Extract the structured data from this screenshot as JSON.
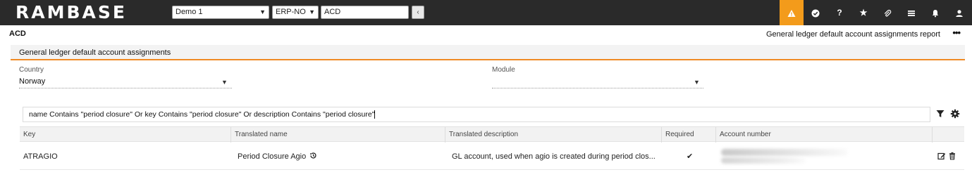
{
  "topbar": {
    "logo": "RAMBASE",
    "company": "Demo 1",
    "country": "ERP-NO",
    "app_code": "ACD",
    "back_label": "‹",
    "icons": [
      "warning-icon",
      "check-badge-icon",
      "help-icon",
      "star-icon",
      "paperclip-icon",
      "list-icon",
      "bell-icon",
      "user-icon"
    ],
    "accent_color": "#f39b1b"
  },
  "header": {
    "page_code": "ACD",
    "report_title": "General ledger default account assignments report",
    "more_label": "•••"
  },
  "card": {
    "title": "General ledger default account assignments",
    "accent_color": "#f08a24",
    "country_label": "Country",
    "country_value": "Norway",
    "module_label": "Module",
    "module_value": ""
  },
  "search": {
    "query": "name Contains \"period closure\" Or key Contains \"period closure\" Or description Contains \"period closure\""
  },
  "table": {
    "columns": [
      "Key",
      "Translated name",
      "Translated description",
      "Required",
      "Account number"
    ],
    "rows": [
      {
        "key": "ATRAGIO",
        "translated_name": "Period Closure Agio",
        "translated_description": "GL account, used when agio is created during period clos...",
        "required": "✔",
        "account_number": ""
      }
    ]
  }
}
